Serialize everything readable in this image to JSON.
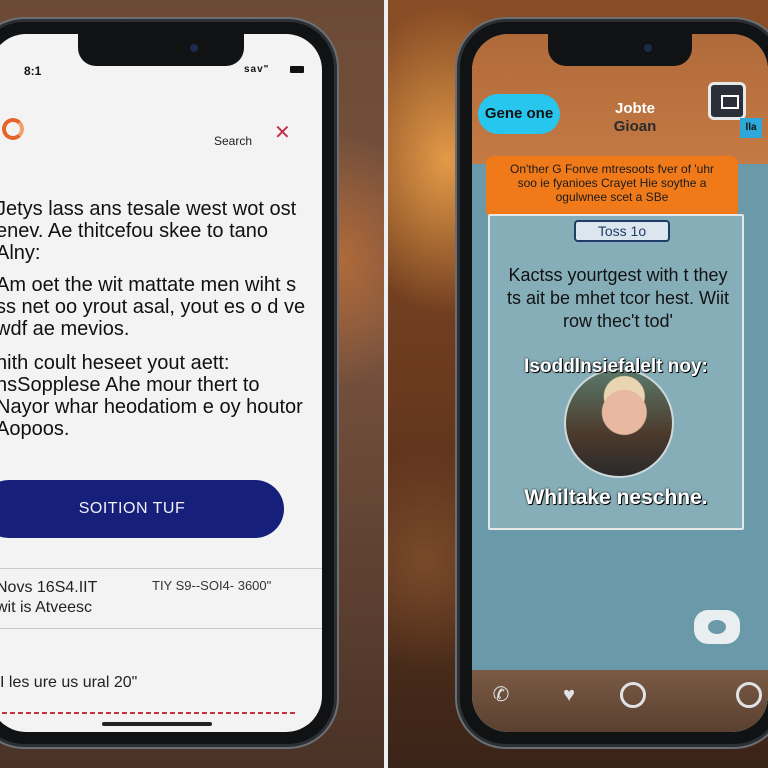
{
  "left_phone": {
    "status_time": "8:1",
    "status_right": "sav\"",
    "search_label": "Search",
    "paragraphs": [
      "Jetys lass ans tesale west wot ost enev. Ae thitcefou skee to tano Alny:",
      "Am oet the wit mattate men wiht s ss net oo yrout asal, yout es o d ve wdf ae mevios.",
      "hith coult heseet yout aett: nsSopplese Ahe mour thert to Nayor whar heodatiom e oy houtor Aopoos."
    ],
    "cta_label": "SOITION TUF",
    "info_left_line1": "Novs 16S4.IIT",
    "info_left_line2": "wit is Atveesc",
    "info_right": "TIY S9--SOI4- 3600\"",
    "footer_line": "I les ure us ural 20\""
  },
  "right_phone": {
    "pill_label": "Gene one",
    "title": "Jobte",
    "title_sub": "Gioan",
    "small_badge": "lla",
    "banner_text": "On'ther G Fonve mtresoots fver of 'uhr soo ie fyanioes Crayet Hie soythe a ogulwnee scet a SBe",
    "card_tag": "Toss 1o",
    "card_text": "Kactss yourtgest with t they ts ait be mhet tcor hest. Wiit row thec't tod'",
    "card_bold": "Isoddlnsiefalelt noy:",
    "card_caption": "Whiltake neschne."
  },
  "icons": {
    "app_logo": "ring-logo-icon",
    "close": "close-icon",
    "camera": "camera-icon",
    "chat": "chat-icon",
    "phone": "phone-icon",
    "heart": "heart-icon"
  },
  "colors": {
    "cta_bg": "#16207a",
    "accent_orange": "#f07a1a",
    "pill_blue": "#27c6ee",
    "close_red": "#c0304a"
  }
}
